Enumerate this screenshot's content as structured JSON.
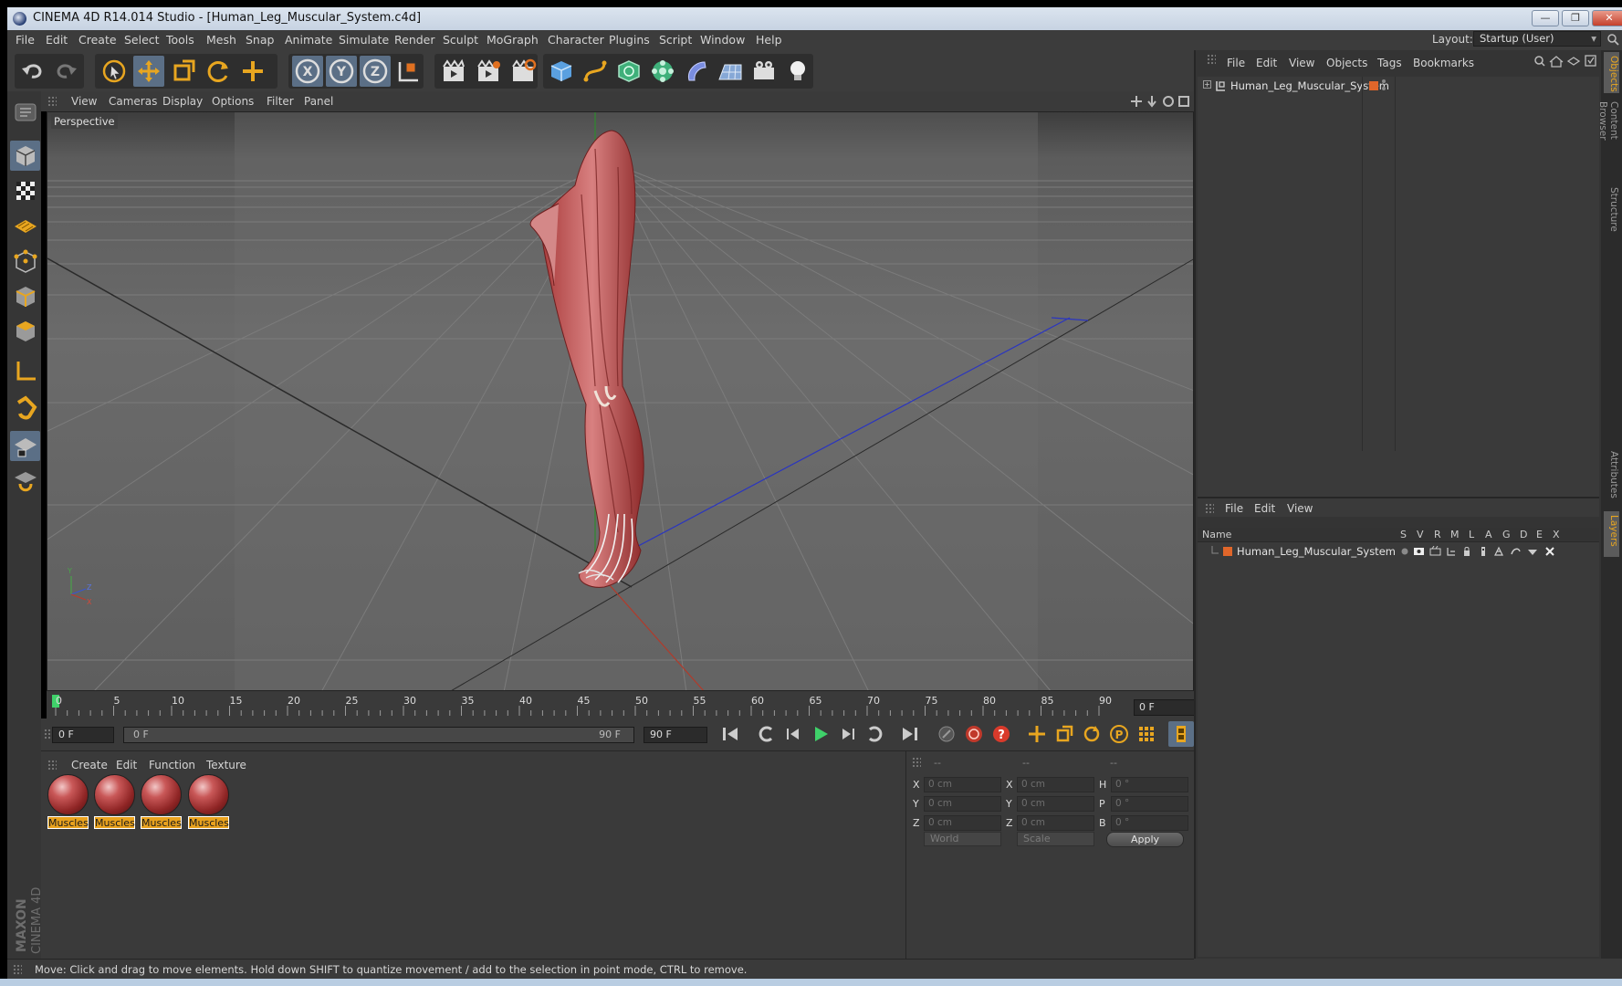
{
  "window": {
    "title": "CINEMA 4D R14.014 Studio - [Human_Leg_Muscular_System.c4d]",
    "buttons": {
      "minimize": "—",
      "restore": "❐",
      "close": "✕"
    }
  },
  "menubar": {
    "items": [
      "File",
      "Edit",
      "Create",
      "Select",
      "Tools",
      "Mesh",
      "Snap",
      "Animate",
      "Simulate",
      "Render",
      "Sculpt",
      "MoGraph",
      "Character",
      "Plugins",
      "Script",
      "Window",
      "Help"
    ],
    "layout_label": "Layout:",
    "layout_value": "Startup (User)"
  },
  "viewport": {
    "menu": [
      "View",
      "Cameras",
      "Display",
      "Options",
      "Filter",
      "Panel"
    ],
    "label": "Perspective",
    "axis": {
      "y": "Y",
      "z": "Z",
      "x": "X"
    }
  },
  "timeline": {
    "ticks": [
      "0",
      "5",
      "10",
      "15",
      "20",
      "25",
      "30",
      "35",
      "40",
      "45",
      "50",
      "55",
      "60",
      "65",
      "70",
      "75",
      "80",
      "85",
      "90"
    ],
    "current_frame_display": "0 F"
  },
  "transport": {
    "start_field": "0 F",
    "range_start": "0 F",
    "range_end": "90 F",
    "end_field": "90 F"
  },
  "materials": {
    "menu": [
      "Create",
      "Edit",
      "Function",
      "Texture"
    ],
    "items": [
      "Muscles",
      "Muscles",
      "Muscles",
      "Muscles"
    ]
  },
  "coordinates": {
    "headers": [
      "--",
      "--",
      "--"
    ],
    "rows": [
      {
        "pos_label": "X",
        "pos_value": "0 cm",
        "size_label": "X",
        "size_value": "0 cm",
        "rot_label": "H",
        "rot_value": "0 °"
      },
      {
        "pos_label": "Y",
        "pos_value": "0 cm",
        "size_label": "Y",
        "size_value": "0 cm",
        "rot_label": "P",
        "rot_value": "0 °"
      },
      {
        "pos_label": "Z",
        "pos_value": "0 cm",
        "size_label": "Z",
        "size_value": "0 cm",
        "rot_label": "B",
        "rot_value": "0 °"
      }
    ],
    "mode_select": "World",
    "size_select": "Scale",
    "apply_label": "Apply"
  },
  "object_manager": {
    "menu": [
      "File",
      "Edit",
      "View",
      "Objects",
      "Tags",
      "Bookmarks"
    ],
    "objects": [
      {
        "name": "Human_Leg_Muscular_System",
        "color": "#e0662a"
      }
    ]
  },
  "layer_manager": {
    "menu": [
      "File",
      "Edit",
      "View"
    ],
    "columns": [
      "Name",
      "S",
      "V",
      "R",
      "M",
      "L",
      "A",
      "G",
      "D",
      "E",
      "X"
    ],
    "rows": [
      {
        "name": "Human_Leg_Muscular_System",
        "color": "#e0662a"
      }
    ]
  },
  "side_tabs": [
    "Objects",
    "Content Browser",
    "Structure",
    "Attributes",
    "Layers"
  ],
  "brand": {
    "maxon": "MAXON",
    "product": "CINEMA 4D"
  },
  "status": "Move: Click and drag to move elements. Hold down SHIFT to quantize movement / add to the selection in point mode, CTRL to remove.",
  "colors": {
    "accent": "#e8a620",
    "active_tool": "#5b6f86",
    "ui_bg": "#3a3a3a"
  }
}
